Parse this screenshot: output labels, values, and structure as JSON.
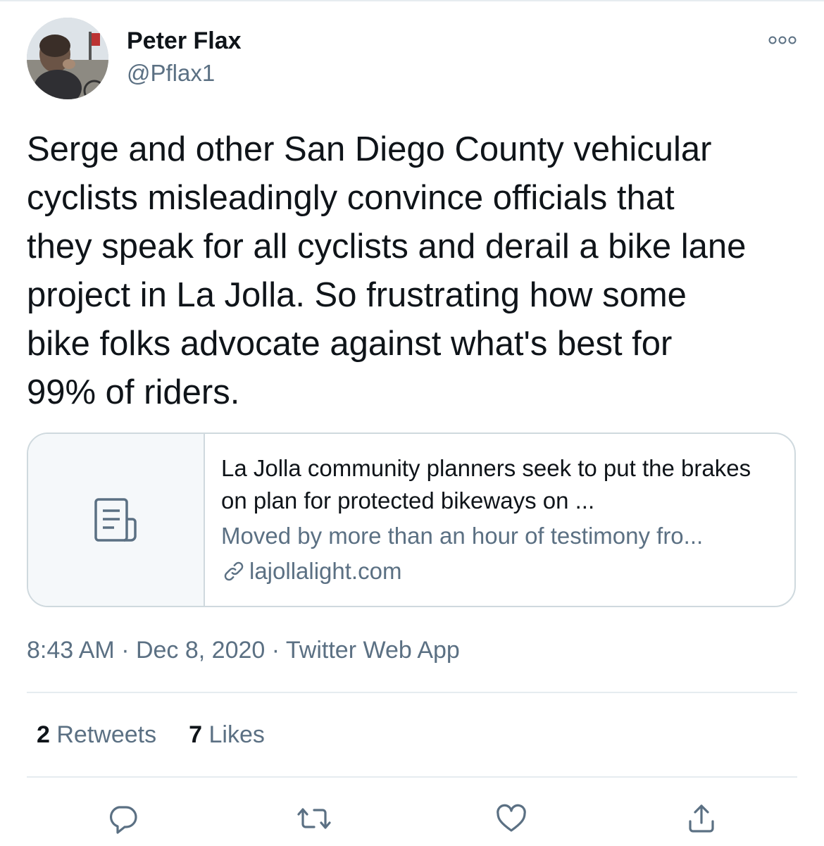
{
  "author": {
    "display_name": "Peter Flax",
    "handle": "@Pflax1"
  },
  "tweet": {
    "text": "Serge and other San Diego County vehicular\ncyclists misleadingly convince officials that\nthey speak for all cyclists and derail a bike lane\nproject in La Jolla. So frustrating how some\nbike folks advocate against what's best for\n99% of riders."
  },
  "card": {
    "title": "La Jolla community planners seek to put the brakes on plan for protected bikeways on ...",
    "description": "Moved by more than an hour of testimony fro...",
    "domain": "lajollalight.com",
    "thumbnail_icon": "document-icon",
    "link_icon": "link-icon"
  },
  "meta": {
    "text": "8:43 AM · Dec 8, 2020 · Twitter Web App"
  },
  "stats": {
    "retweets_count": "2",
    "retweets_label": "Retweets",
    "likes_count": "7",
    "likes_label": "Likes"
  },
  "actions": [
    "reply-icon",
    "retweet-icon",
    "like-icon",
    "share-icon"
  ],
  "colors": {
    "text_primary": "#0f1419",
    "text_secondary": "#5b7083",
    "border": "#cfd9de",
    "divider": "#e6ecf0",
    "card_thumb_bg": "#f5f8fa"
  }
}
